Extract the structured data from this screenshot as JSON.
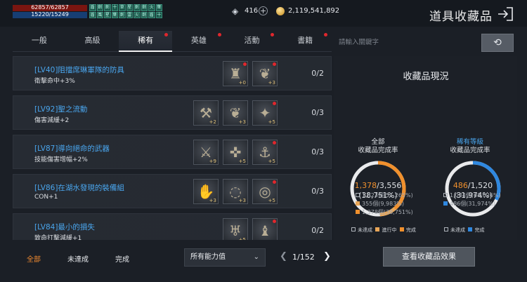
{
  "player": {
    "hp": "62857/62857",
    "mp": "15220/15249"
  },
  "buff_icons": [
    "盾",
    "劍",
    "劍",
    "十",
    "草",
    "星",
    "劍",
    "劍",
    "火",
    "葉",
    "盾",
    "風",
    "星",
    "葉",
    "劍",
    "雷",
    "火",
    "劍",
    "盾",
    "十"
  ],
  "currency": {
    "gems": "416",
    "gold": "2,119,541,892"
  },
  "header": {
    "title": "道具收藏品"
  },
  "tabs": [
    {
      "label": "一般",
      "badge": false
    },
    {
      "label": "高級",
      "badge": false
    },
    {
      "label": "稀有",
      "badge": true,
      "active": true
    },
    {
      "label": "英雄",
      "badge": true
    },
    {
      "label": "活動",
      "badge": true
    },
    {
      "label": "書籍",
      "badge": true
    }
  ],
  "collections": [
    {
      "name": "[LV40]阻擋席琳軍隊的防具",
      "effect": "衛擊命中+3%",
      "progress": "0/2",
      "items": [
        {
          "icon": "♜",
          "level": "+0",
          "badge": true
        },
        {
          "icon": "❦",
          "level": "+3",
          "badge": true
        }
      ]
    },
    {
      "name": "[LV92]聖之流動",
      "effect": "傷害減緩+2",
      "progress": "0/3",
      "items": [
        {
          "icon": "⚒",
          "level": "+2",
          "badge": false
        },
        {
          "icon": "❦",
          "level": "+3",
          "badge": false
        },
        {
          "icon": "✦",
          "level": "+5",
          "badge": true
        }
      ]
    },
    {
      "name": "[LV87]導向絕命的武器",
      "effect": "技能傷害增幅+2%",
      "progress": "0/3",
      "items": [
        {
          "icon": "⚔",
          "level": "+9",
          "badge": false
        },
        {
          "icon": "✜",
          "level": "+5",
          "badge": false
        },
        {
          "icon": "⚓",
          "level": "+5",
          "badge": true
        }
      ]
    },
    {
      "name": "[LV86]在湖水發現的裝備組",
      "effect": "CON+1",
      "progress": "0/3",
      "items": [
        {
          "icon": "✋",
          "level": "+3",
          "badge": false
        },
        {
          "icon": "◌",
          "level": "+3",
          "badge": false
        },
        {
          "icon": "◎",
          "level": "+5",
          "badge": true
        }
      ]
    },
    {
      "name": "[LV84]最小的損失",
      "effect": "致命打擊減緩+1",
      "progress": "0/2",
      "items": [
        {
          "icon": "♅",
          "level": "+5",
          "badge": false
        },
        {
          "icon": "♝",
          "level": "",
          "badge": true
        }
      ]
    }
  ],
  "filters": [
    {
      "label": "全部",
      "active": true
    },
    {
      "label": "未達成",
      "active": false
    },
    {
      "label": "完成",
      "active": false
    }
  ],
  "stat_filter": {
    "selected": "所有能力值"
  },
  "pagination": {
    "label": "1/152",
    "current": 1,
    "total": 152
  },
  "search": {
    "placeholder": "請輸入關鍵字"
  },
  "status_panel": {
    "title": "收藏品現況",
    "overall": {
      "label_1": "全部",
      "label_2": "收藏品完成率",
      "done": "1,378",
      "total": "3,556",
      "percent": "(38,751%)",
      "fraction_complete": 0.3875,
      "fraction_in_progress": 0.0998,
      "legend": [
        {
          "type": "empty",
          "text": "1,823個(51,265%)"
        },
        {
          "type": "lorange",
          "text": "355個(9,983%)"
        },
        {
          "type": "orange",
          "text": "1,378個(38,751%)"
        }
      ],
      "keys": [
        "未達成",
        "進行中",
        "完成"
      ]
    },
    "rare": {
      "label_1": "稀有等級",
      "label_2": "收藏品完成率",
      "done": "486",
      "total": "1,520",
      "percent": "(31,974%)",
      "fraction_complete": 0.3197,
      "legend": [
        {
          "type": "empty",
          "text": "1,034個(68,026%)"
        },
        {
          "type": "blue",
          "text": "486個(31,974%)"
        }
      ],
      "keys": [
        "未達成",
        "完成"
      ]
    }
  },
  "buttons": {
    "view_effects": "查看收藏品效果"
  },
  "colors": {
    "accent_blue": "#4aa6ee",
    "accent_orange": "#f0902d",
    "badge_red": "#e0272d"
  }
}
